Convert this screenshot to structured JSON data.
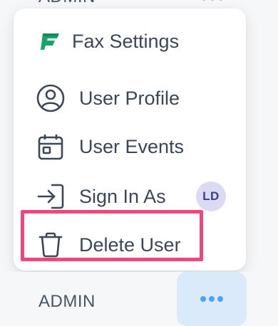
{
  "top_row": {
    "role": "ADMIN"
  },
  "menu": {
    "items": [
      {
        "label": "Fax Settings",
        "icon": "fax-logo-icon"
      },
      {
        "label": "User Profile",
        "icon": "user-circle-icon"
      },
      {
        "label": "User Events",
        "icon": "calendar-icon"
      },
      {
        "label": "Sign In As",
        "icon": "sign-in-icon",
        "avatar": "LD"
      },
      {
        "label": "Delete User",
        "icon": "trash-icon"
      }
    ]
  },
  "bottom_row": {
    "role": "ADMIN",
    "more_icon": "more-horizontal-icon"
  },
  "colors": {
    "brand_green": "#1aa36b",
    "icon_gray": "#3b4657",
    "highlight": "#f0467a",
    "more_button_bg": "#dbeafb",
    "more_dots": "#4da3f5",
    "avatar_bg": "#dcd9f2"
  }
}
